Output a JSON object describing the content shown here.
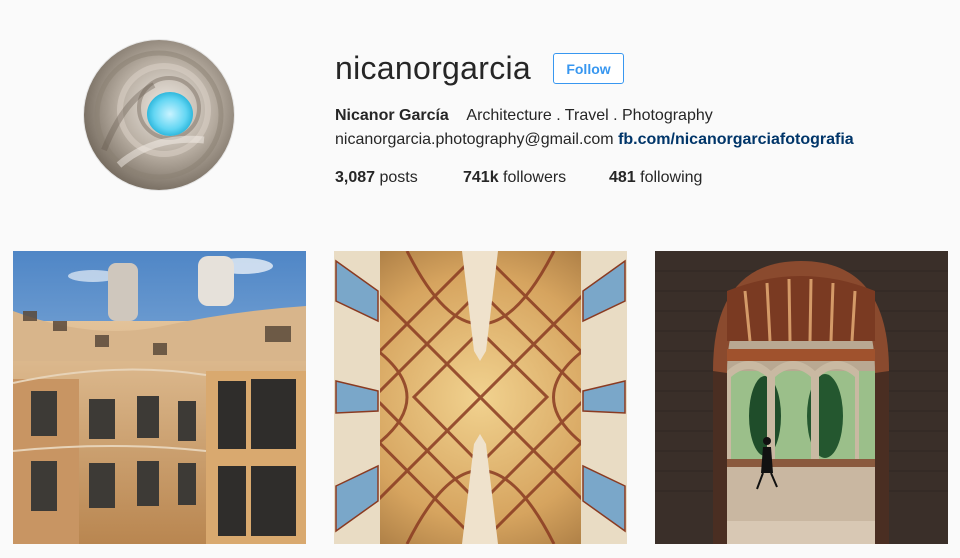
{
  "profile": {
    "username": "nicanorgarcia",
    "follow_label": "Follow",
    "full_name": "Nicanor García",
    "bio": "Architecture . Travel . Photography",
    "email": "nicanorgarcia.photography@gmail.com",
    "link": "fb.com/nicanorgarciafotografia"
  },
  "stats": {
    "posts_count": "3,087",
    "posts_label": "posts",
    "followers_count": "741k",
    "followers_label": "followers",
    "following_count": "481",
    "following_label": "following"
  },
  "colors": {
    "accent": "#3897f0",
    "link": "#003569",
    "background": "#fafafa",
    "text": "#262626"
  }
}
